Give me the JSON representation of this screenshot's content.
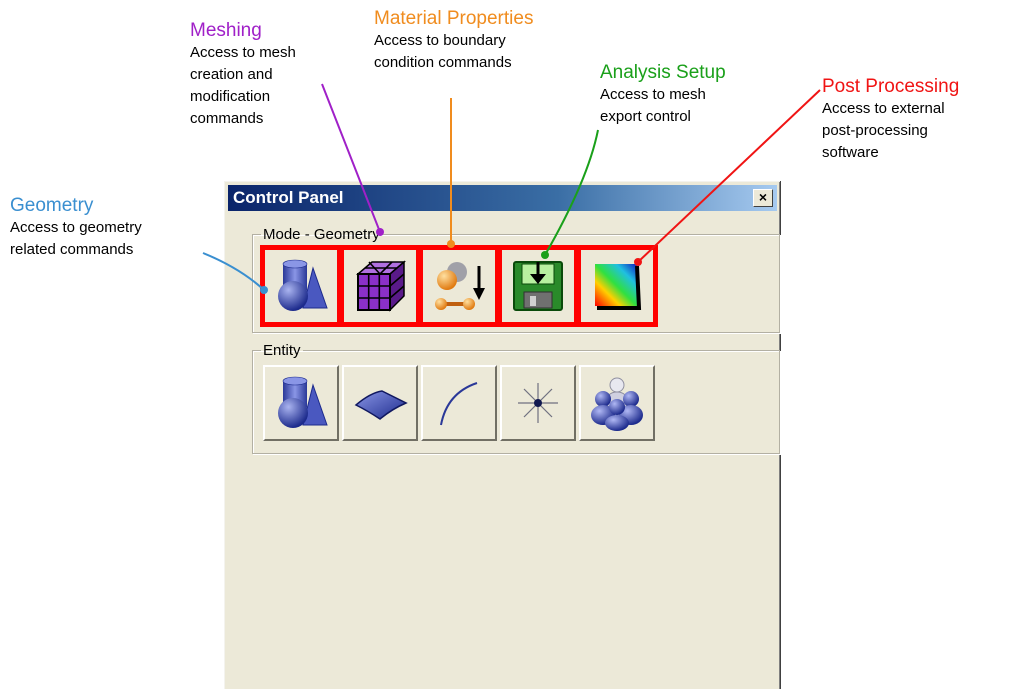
{
  "annotations": {
    "geometry": {
      "title": "Geometry",
      "desc": "Access to geometry\nrelated commands",
      "color": "#3a8fd0"
    },
    "meshing": {
      "title": "Meshing",
      "desc": "Access to mesh\ncreation and\nmodification\ncommands",
      "color": "#a020c8"
    },
    "material": {
      "title": "Material Properties",
      "desc": "Access to boundary\ncondition commands",
      "color": "#f08c1e"
    },
    "analysis": {
      "title": "Analysis Setup",
      "desc": "Access to mesh\nexport control",
      "color": "#1aa01a"
    },
    "post": {
      "title": "Post Processing",
      "desc": "Access to external\npost-processing\nsoftware",
      "color": "#f01414"
    }
  },
  "window": {
    "title": "Control Panel",
    "close_label": "×"
  },
  "mode_group": {
    "legend": "Mode - Geometry",
    "buttons": [
      {
        "icon": "geometry-shapes-icon"
      },
      {
        "icon": "mesh-cube-icon"
      },
      {
        "icon": "material-properties-icon"
      },
      {
        "icon": "floppy-export-icon"
      },
      {
        "icon": "gradient-postprocess-icon"
      }
    ]
  },
  "entity_group": {
    "legend": "Entity",
    "buttons": [
      {
        "icon": "volume-icon"
      },
      {
        "icon": "surface-icon"
      },
      {
        "icon": "curve-icon"
      },
      {
        "icon": "vertex-icon"
      },
      {
        "icon": "group-icon"
      }
    ]
  },
  "highlight_color": "#ff0000"
}
